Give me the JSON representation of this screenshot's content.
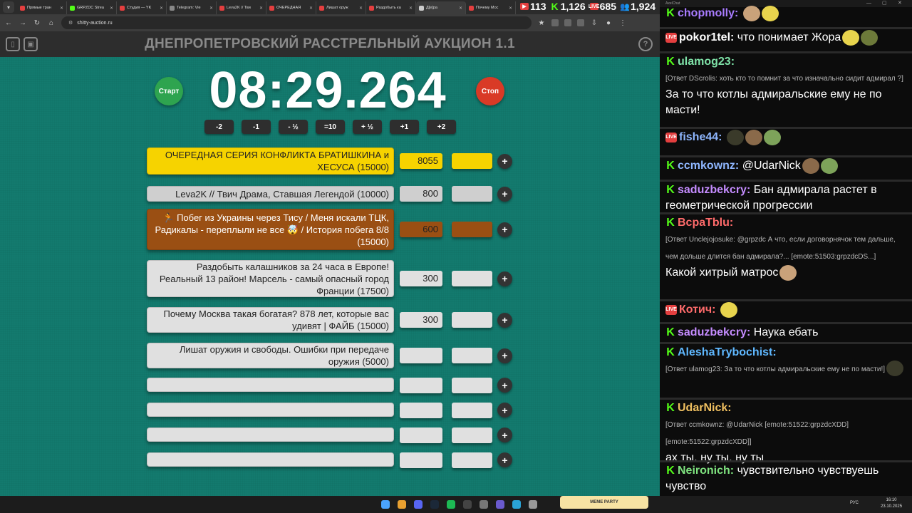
{
  "browser": {
    "tabs": [
      {
        "title": "Прямые тран",
        "color": "#e43f3f"
      },
      {
        "title": "GRPZDC Strea",
        "color": "#53fc18"
      },
      {
        "title": "Студия — YK",
        "color": "#e43f3f"
      },
      {
        "title": "Telegram: Vie",
        "color": "#888888"
      },
      {
        "title": "Leva2K // Тви",
        "color": "#e43f3f"
      },
      {
        "title": "ОЧЕРЕДНАЯ",
        "color": "#e43f3f"
      },
      {
        "title": "Лишат оруж",
        "color": "#e43f3f"
      },
      {
        "title": "Раздобыть ка",
        "color": "#e43f3f"
      },
      {
        "title": "Д[e]ра",
        "color": "#cccccc"
      },
      {
        "title": "Почему Мос",
        "color": "#e43f3f"
      }
    ],
    "url": "shitty-auction.ru"
  },
  "counters": [
    {
      "value": "113",
      "platform": "youtube",
      "color": "#e43f3f"
    },
    {
      "value": "1,126",
      "platform": "kick",
      "color": "#53fc18"
    },
    {
      "value": "685",
      "platform": "vkplay",
      "color": "#e43f3f"
    },
    {
      "value": "1,924",
      "platform": "total",
      "color": "#6fa8ff"
    }
  ],
  "auction": {
    "title": "ДНЕПРОПЕТРОВСКИЙ РАССТРЕЛЬНЫЙ АУКЦИОН 1.1",
    "timer": "08:29.264",
    "start_label": "Старт",
    "stop_label": "Стоп",
    "help_label": "?",
    "adjust_buttons": [
      "-2",
      "-1",
      "- ½",
      "=10",
      "+ ½",
      "+1",
      "+2"
    ],
    "lots": [
      {
        "name": "ОЧЕРЕДНАЯ СЕРИЯ КОНФЛИКТА БРАТИШКИНА и ХЕСУСА (15000)",
        "amount": "8055",
        "tier": "gold"
      },
      {
        "name": "Leva2K // Твич Драма, Ставшая Легендой (10000)",
        "amount": "800",
        "tier": "silver"
      },
      {
        "name": "🏃 Побег из Украины через Тису / Меня искали ТЦК, Радикалы - переплыли не все 🤯 / История побега 8/8 (15000)",
        "amount": "600",
        "tier": "bronze"
      },
      {
        "name": "Раздобыть калашников за 24 часа в Европе! Реальный 13 район! Марсель - самый опасный город Франции (17500)",
        "amount": "300",
        "tier": ""
      },
      {
        "name": "Почему Москва такая богатая? 878 лет, которые вас удивят | ФАЙБ (15000)",
        "amount": "300",
        "tier": ""
      },
      {
        "name": "Лишат оружия и свободы. Ошибки при передаче оружия (5000)",
        "amount": "",
        "tier": ""
      },
      {
        "name": "",
        "amount": "",
        "tier": ""
      },
      {
        "name": "",
        "amount": "",
        "tier": ""
      },
      {
        "name": "",
        "amount": "",
        "tier": ""
      },
      {
        "name": "",
        "amount": "",
        "tier": ""
      }
    ],
    "add_label": "+"
  },
  "chat": {
    "window_title": "AxelChat",
    "messages": [
      {
        "platform": "kick",
        "nick": "chopmolly",
        "nick_color": "#a97cff",
        "reply": "",
        "text": "",
        "emotes": 2
      },
      {
        "platform": "live",
        "nick": "pokor1tel",
        "nick_color": "#ffffff",
        "reply": "",
        "text": "что понимает Жора",
        "emotes": 2
      },
      {
        "platform": "kick",
        "nick": "ulamog23",
        "nick_color": "#7fe3a8",
        "reply": "[Ответ DScrolis: хоть кто то помнит за что изначально сидит адмирал ?]",
        "text": "За то что котлы адмиральские ему не по масти!",
        "emotes": 0
      },
      {
        "platform": "live",
        "nick": "fishe44",
        "nick_color": "#8fb7ff",
        "reply": "",
        "text": "",
        "emotes": 3
      },
      {
        "platform": "kick",
        "nick": "ccmkownz",
        "nick_color": "#8fb7ff",
        "reply": "",
        "text": "@UdarNick",
        "emotes": 2
      },
      {
        "platform": "kick",
        "nick": "saduzbekcry",
        "nick_color": "#c58cff",
        "reply": "",
        "text": "Бан адмирала растет в геометрической прогрессии",
        "emotes": 0
      },
      {
        "platform": "kick",
        "nick": "BcpaTblu",
        "nick_color": "#ff6b6b",
        "reply": "[Ответ Unclejojosuke: @grpzdc А что, если договорнячок тем дальше, чем дольше длится бан адмирала?... [emote:51503:grpzdcDS...]",
        "text": "Какой хитрый матрос",
        "emotes": 1
      },
      {
        "platform": "live",
        "nick": "Котич",
        "nick_color": "#ff6b6b",
        "reply": "",
        "text": "",
        "emotes": 1
      },
      {
        "platform": "kick",
        "nick": "saduzbekcry",
        "nick_color": "#c58cff",
        "reply": "",
        "text": "Наука ебать",
        "emotes": 0
      },
      {
        "platform": "kick",
        "nick": "AleshaTrybochist",
        "nick_color": "#5fb8ff",
        "reply": "[Ответ ulamog23: За то что котлы адмиральские ему не по масти!]",
        "text": "",
        "emotes": 1
      },
      {
        "platform": "kick",
        "nick": "UdarNick",
        "nick_color": "#f0c060",
        "reply": "[Ответ ccmkownz: @UdarNick [emote:51522:grpzdcXDD] [emote:51522:grpzdcXDD]]",
        "text": "ах ты, ну ты, ну ты",
        "emotes": 0
      },
      {
        "platform": "kick",
        "nick": "Neironich",
        "nick_color": "#7fe37f",
        "reply": "",
        "text": "чувствительно чувствуешь чувство",
        "emotes": 0
      }
    ]
  },
  "taskbar": {
    "meme_label": "MEME PARTY",
    "lang": "РУС",
    "time": "16:10",
    "date": "23.10.2025"
  }
}
